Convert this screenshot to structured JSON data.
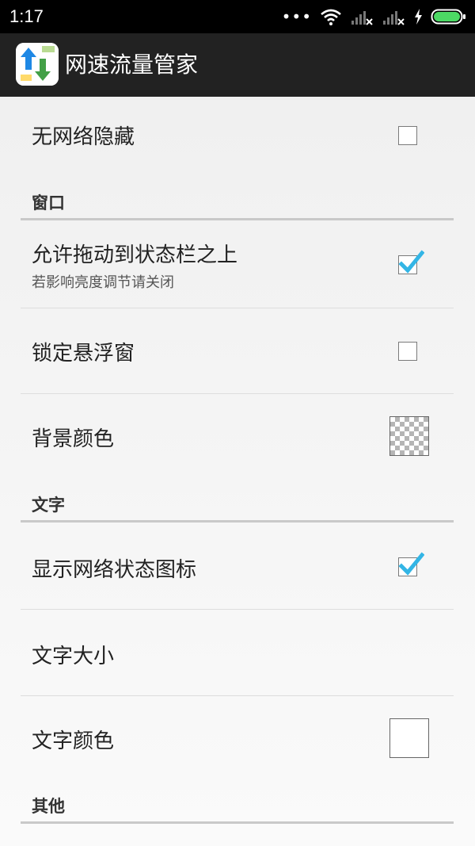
{
  "status_bar": {
    "time": "1:17",
    "icons": [
      "more-dots-icon",
      "wifi-icon",
      "signal-no-sim-icon",
      "signal-no-sim-icon",
      "charging-icon",
      "battery-icon"
    ]
  },
  "app_bar": {
    "title": "网速流量管家",
    "icon": "app-arrows-icon"
  },
  "colors": {
    "checkbox_check": "#33b5e5",
    "section_line": "#c9c9c9",
    "action_bar": "#222222"
  },
  "settings": {
    "hide_no_network": {
      "title": "无网络隐藏",
      "checked": false
    },
    "section_window": {
      "title": "窗口"
    },
    "allow_drag": {
      "title": "允许拖动到状态栏之上",
      "summary": "若影响亮度调节请关闭",
      "checked": true
    },
    "lock_float": {
      "title": "锁定悬浮窗",
      "checked": false
    },
    "bg_color": {
      "title": "背景颜色",
      "value": "transparent"
    },
    "section_text": {
      "title": "文字"
    },
    "show_net_icon": {
      "title": "显示网络状态图标",
      "checked": true
    },
    "text_size": {
      "title": "文字大小"
    },
    "text_color": {
      "title": "文字颜色",
      "value": "#ffffff"
    },
    "section_other": {
      "title": "其他"
    }
  }
}
